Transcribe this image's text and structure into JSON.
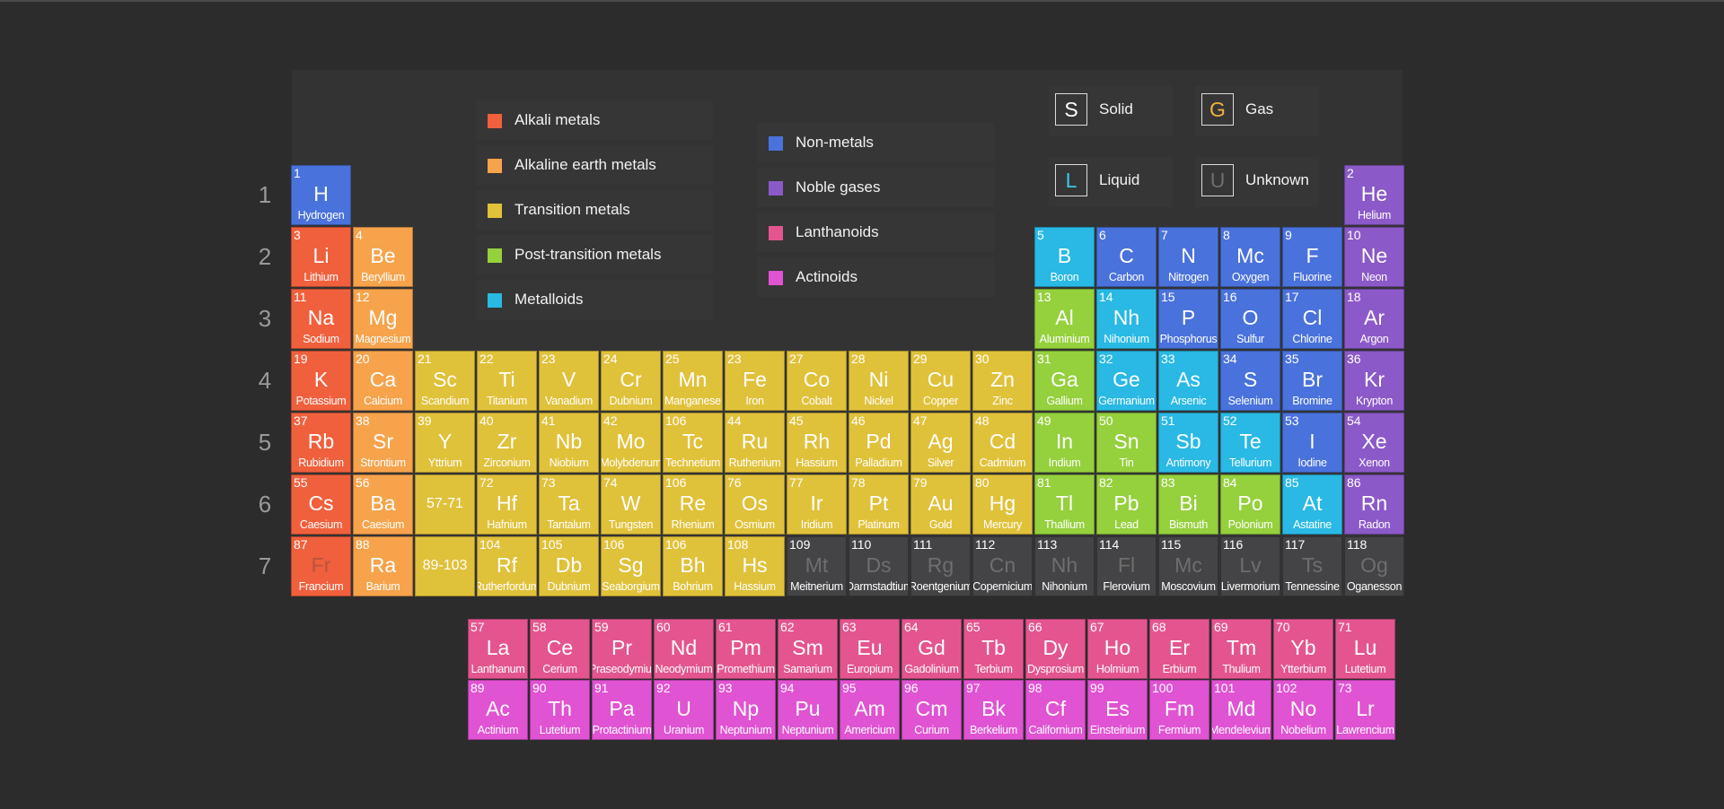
{
  "colors": {
    "alkali": "#f0603d",
    "alkaline": "#f6a34c",
    "transition": "#e0c13a",
    "post": "#95d03d",
    "metalloid": "#29b9e4",
    "nonmetal": "#4a72dc",
    "noble": "#8b59c8",
    "lanthanoid": "#e4558f",
    "actinoid": "#e053d2",
    "unknown": "#444446"
  },
  "periods": [
    "1",
    "2",
    "3",
    "4",
    "5",
    "6",
    "7"
  ],
  "legend": [
    {
      "label": "Alkali metals",
      "category": "alkali"
    },
    {
      "label": "Alkaline earth metals",
      "category": "alkaline"
    },
    {
      "label": "Transition metals",
      "category": "transition"
    },
    {
      "label": "Post-transition metals",
      "category": "post"
    },
    {
      "label": "Metalloids",
      "category": "metalloid"
    },
    {
      "label": "Non-metals",
      "category": "nonmetal"
    },
    {
      "label": "Noble gases",
      "category": "noble"
    },
    {
      "label": "Lanthanoids",
      "category": "lanthanoid"
    },
    {
      "label": "Actinoids",
      "category": "actinoid"
    }
  ],
  "states": [
    {
      "letter": "S",
      "label": "Solid",
      "color": "#ffffff"
    },
    {
      "letter": "G",
      "label": "Gas",
      "color": "#f2b33d"
    },
    {
      "letter": "L",
      "label": "Liquid",
      "color": "#3cc9e6"
    },
    {
      "letter": "U",
      "label": "Unknown",
      "color": "#6e6e6e"
    }
  ],
  "elements": [
    {
      "n": "1",
      "s": "H",
      "name": "Hydrogen",
      "c": "nonmetal",
      "row": 1,
      "col": 1
    },
    {
      "n": "2",
      "s": "He",
      "name": "Helium",
      "c": "noble",
      "row": 1,
      "col": 18
    },
    {
      "n": "3",
      "s": "Li",
      "name": "Lithium",
      "c": "alkali",
      "row": 2,
      "col": 1
    },
    {
      "n": "4",
      "s": "Be",
      "name": "Beryllium",
      "c": "alkaline",
      "row": 2,
      "col": 2
    },
    {
      "n": "5",
      "s": "B",
      "name": "Boron",
      "c": "metalloid",
      "row": 2,
      "col": 13
    },
    {
      "n": "6",
      "s": "C",
      "name": "Carbon",
      "c": "nonmetal",
      "row": 2,
      "col": 14
    },
    {
      "n": "7",
      "s": "N",
      "name": "Nitrogen",
      "c": "nonmetal",
      "row": 2,
      "col": 15
    },
    {
      "n": "8",
      "s": "Mc",
      "name": "Oxygen",
      "c": "nonmetal",
      "row": 2,
      "col": 16
    },
    {
      "n": "9",
      "s": "F",
      "name": "Fluorine",
      "c": "nonmetal",
      "row": 2,
      "col": 17
    },
    {
      "n": "10",
      "s": "Ne",
      "name": "Neon",
      "c": "noble",
      "row": 2,
      "col": 18
    },
    {
      "n": "11",
      "s": "Na",
      "name": "Sodium",
      "c": "alkali",
      "row": 3,
      "col": 1
    },
    {
      "n": "12",
      "s": "Mg",
      "name": "Magnesium",
      "c": "alkaline",
      "row": 3,
      "col": 2
    },
    {
      "n": "13",
      "s": "Al",
      "name": "Aluminium",
      "c": "post",
      "row": 3,
      "col": 13
    },
    {
      "n": "14",
      "s": "Nh",
      "name": "Nihonium",
      "c": "metalloid",
      "row": 3,
      "col": 14
    },
    {
      "n": "15",
      "s": "P",
      "name": "Phosphorus",
      "c": "nonmetal",
      "row": 3,
      "col": 15
    },
    {
      "n": "16",
      "s": "O",
      "name": "Sulfur",
      "c": "nonmetal",
      "row": 3,
      "col": 16
    },
    {
      "n": "17",
      "s": "Cl",
      "name": "Chlorine",
      "c": "nonmetal",
      "row": 3,
      "col": 17
    },
    {
      "n": "18",
      "s": "Ar",
      "name": "Argon",
      "c": "noble",
      "row": 3,
      "col": 18
    },
    {
      "n": "19",
      "s": "K",
      "name": "Potassium",
      "c": "alkali",
      "row": 4,
      "col": 1
    },
    {
      "n": "20",
      "s": "Ca",
      "name": "Calcium",
      "c": "alkaline",
      "row": 4,
      "col": 2
    },
    {
      "n": "21",
      "s": "Sc",
      "name": "Scandium",
      "c": "transition",
      "row": 4,
      "col": 3
    },
    {
      "n": "22",
      "s": "Ti",
      "name": "Titanium",
      "c": "transition",
      "row": 4,
      "col": 4
    },
    {
      "n": "23",
      "s": "V",
      "name": "Vanadium",
      "c": "transition",
      "row": 4,
      "col": 5
    },
    {
      "n": "24",
      "s": "Cr",
      "name": "Dubnium",
      "c": "transition",
      "row": 4,
      "col": 6
    },
    {
      "n": "25",
      "s": "Mn",
      "name": "Manganese",
      "c": "transition",
      "row": 4,
      "col": 7
    },
    {
      "n": "23",
      "s": "Fe",
      "name": "Iron",
      "c": "transition",
      "row": 4,
      "col": 8
    },
    {
      "n": "27",
      "s": "Co",
      "name": "Cobalt",
      "c": "transition",
      "row": 4,
      "col": 9
    },
    {
      "n": "28",
      "s": "Ni",
      "name": "Nickel",
      "c": "transition",
      "row": 4,
      "col": 10
    },
    {
      "n": "29",
      "s": "Cu",
      "name": "Copper",
      "c": "transition",
      "row": 4,
      "col": 11
    },
    {
      "n": "30",
      "s": "Zn",
      "name": "Zinc",
      "c": "transition",
      "row": 4,
      "col": 12
    },
    {
      "n": "31",
      "s": "Ga",
      "name": "Gallium",
      "c": "post",
      "row": 4,
      "col": 13
    },
    {
      "n": "32",
      "s": "Ge",
      "name": "Germanium",
      "c": "metalloid",
      "row": 4,
      "col": 14
    },
    {
      "n": "33",
      "s": "As",
      "name": "Arsenic",
      "c": "metalloid",
      "row": 4,
      "col": 15
    },
    {
      "n": "34",
      "s": "S",
      "name": "Selenium",
      "c": "nonmetal",
      "row": 4,
      "col": 16
    },
    {
      "n": "35",
      "s": "Br",
      "name": "Bromine",
      "c": "nonmetal",
      "row": 4,
      "col": 17
    },
    {
      "n": "36",
      "s": "Kr",
      "name": "Krypton",
      "c": "noble",
      "row": 4,
      "col": 18
    },
    {
      "n": "37",
      "s": "Rb",
      "name": "Rubidium",
      "c": "alkali",
      "row": 5,
      "col": 1
    },
    {
      "n": "38",
      "s": "Sr",
      "name": "Strontium",
      "c": "alkaline",
      "row": 5,
      "col": 2
    },
    {
      "n": "39",
      "s": "Y",
      "name": "Yttrium",
      "c": "transition",
      "row": 5,
      "col": 3
    },
    {
      "n": "40",
      "s": "Zr",
      "name": "Zirconium",
      "c": "transition",
      "row": 5,
      "col": 4
    },
    {
      "n": "41",
      "s": "Nb",
      "name": "Niobium",
      "c": "transition",
      "row": 5,
      "col": 5
    },
    {
      "n": "42",
      "s": "Mo",
      "name": "Molybdenum",
      "c": "transition",
      "row": 5,
      "col": 6
    },
    {
      "n": "106",
      "s": "Tc",
      "name": "Technetium",
      "c": "transition",
      "row": 5,
      "col": 7
    },
    {
      "n": "44",
      "s": "Ru",
      "name": "Ruthenium",
      "c": "transition",
      "row": 5,
      "col": 8
    },
    {
      "n": "45",
      "s": "Rh",
      "name": "Hassium",
      "c": "transition",
      "row": 5,
      "col": 9
    },
    {
      "n": "46",
      "s": "Pd",
      "name": "Palladium",
      "c": "transition",
      "row": 5,
      "col": 10
    },
    {
      "n": "47",
      "s": "Ag",
      "name": "Silver",
      "c": "transition",
      "row": 5,
      "col": 11
    },
    {
      "n": "48",
      "s": "Cd",
      "name": "Cadmium",
      "c": "transition",
      "row": 5,
      "col": 12
    },
    {
      "n": "49",
      "s": "In",
      "name": "Indium",
      "c": "post",
      "row": 5,
      "col": 13
    },
    {
      "n": "50",
      "s": "Sn",
      "name": "Tin",
      "c": "post",
      "row": 5,
      "col": 14
    },
    {
      "n": "51",
      "s": "Sb",
      "name": "Antimony",
      "c": "metalloid",
      "row": 5,
      "col": 15
    },
    {
      "n": "52",
      "s": "Te",
      "name": "Tellurium",
      "c": "metalloid",
      "row": 5,
      "col": 16
    },
    {
      "n": "53",
      "s": "I",
      "name": "Iodine",
      "c": "nonmetal",
      "row": 5,
      "col": 17
    },
    {
      "n": "54",
      "s": "Xe",
      "name": "Xenon",
      "c": "noble",
      "row": 5,
      "col": 18
    },
    {
      "n": "55",
      "s": "Cs",
      "name": "Caesium",
      "c": "alkali",
      "row": 6,
      "col": 1
    },
    {
      "n": "56",
      "s": "Ba",
      "name": "Caesium",
      "c": "alkaline",
      "row": 6,
      "col": 2
    },
    {
      "n": "",
      "s": "57-71",
      "name": "",
      "c": "transition",
      "row": 6,
      "col": 3,
      "range": true
    },
    {
      "n": "72",
      "s": "Hf",
      "name": "Hafnium",
      "c": "transition",
      "row": 6,
      "col": 4
    },
    {
      "n": "73",
      "s": "Ta",
      "name": "Tantalum",
      "c": "transition",
      "row": 6,
      "col": 5
    },
    {
      "n": "74",
      "s": "W",
      "name": "Tungsten",
      "c": "transition",
      "row": 6,
      "col": 6
    },
    {
      "n": "106",
      "s": "Re",
      "name": "Rhenium",
      "c": "transition",
      "row": 6,
      "col": 7
    },
    {
      "n": "76",
      "s": "Os",
      "name": "Osmium",
      "c": "transition",
      "row": 6,
      "col": 8
    },
    {
      "n": "77",
      "s": "Ir",
      "name": "Iridium",
      "c": "transition",
      "row": 6,
      "col": 9
    },
    {
      "n": "78",
      "s": "Pt",
      "name": "Platinum",
      "c": "transition",
      "row": 6,
      "col": 10
    },
    {
      "n": "79",
      "s": "Au",
      "name": "Gold",
      "c": "transition",
      "row": 6,
      "col": 11
    },
    {
      "n": "80",
      "s": "Hg",
      "name": "Mercury",
      "c": "transition",
      "row": 6,
      "col": 12
    },
    {
      "n": "81",
      "s": "Tl",
      "name": "Thallium",
      "c": "post",
      "row": 6,
      "col": 13
    },
    {
      "n": "82",
      "s": "Pb",
      "name": "Lead",
      "c": "post",
      "row": 6,
      "col": 14
    },
    {
      "n": "83",
      "s": "Bi",
      "name": "Bismuth",
      "c": "post",
      "row": 6,
      "col": 15
    },
    {
      "n": "84",
      "s": "Po",
      "name": "Polonium",
      "c": "post",
      "row": 6,
      "col": 16
    },
    {
      "n": "85",
      "s": "At",
      "name": "Astatine",
      "c": "metalloid",
      "row": 6,
      "col": 17
    },
    {
      "n": "86",
      "s": "Rn",
      "name": "Radon",
      "c": "noble",
      "row": 6,
      "col": 18
    },
    {
      "n": "87",
      "s": "Fr",
      "name": "Francium",
      "c": "alkali",
      "row": 7,
      "col": 1,
      "fr": true
    },
    {
      "n": "88",
      "s": "Ra",
      "name": "Barium",
      "c": "alkaline",
      "row": 7,
      "col": 2
    },
    {
      "n": "",
      "s": "89-103",
      "name": "",
      "c": "transition",
      "row": 7,
      "col": 3,
      "range": true
    },
    {
      "n": "104",
      "s": "Rf",
      "name": "Rutherfordum",
      "c": "transition",
      "row": 7,
      "col": 4
    },
    {
      "n": "105",
      "s": "Db",
      "name": "Dubnium",
      "c": "transition",
      "row": 7,
      "col": 5
    },
    {
      "n": "106",
      "s": "Sg",
      "name": "Seaborgium",
      "c": "transition",
      "row": 7,
      "col": 6
    },
    {
      "n": "106",
      "s": "Bh",
      "name": "Bohrium",
      "c": "transition",
      "row": 7,
      "col": 7
    },
    {
      "n": "108",
      "s": "Hs",
      "name": "Hassium",
      "c": "transition",
      "row": 7,
      "col": 8
    },
    {
      "n": "109",
      "s": "Mt",
      "name": "Meitnerium",
      "c": "unknown",
      "row": 7,
      "col": 9
    },
    {
      "n": "110",
      "s": "Ds",
      "name": "Darmstadtium",
      "c": "unknown",
      "row": 7,
      "col": 10
    },
    {
      "n": "111",
      "s": "Rg",
      "name": "Roentgenium",
      "c": "unknown",
      "row": 7,
      "col": 11
    },
    {
      "n": "112",
      "s": "Cn",
      "name": "Copernicium",
      "c": "unknown",
      "row": 7,
      "col": 12
    },
    {
      "n": "113",
      "s": "Nh",
      "name": "Nihonium",
      "c": "unknown",
      "row": 7,
      "col": 13
    },
    {
      "n": "114",
      "s": "Fl",
      "name": "Flerovium",
      "c": "unknown",
      "row": 7,
      "col": 14
    },
    {
      "n": "115",
      "s": "Mc",
      "name": "Moscovium",
      "c": "unknown",
      "row": 7,
      "col": 15
    },
    {
      "n": "116",
      "s": "Lv",
      "name": "Livermorium",
      "c": "unknown",
      "row": 7,
      "col": 16
    },
    {
      "n": "117",
      "s": "Ts",
      "name": "Tennessine",
      "c": "unknown",
      "row": 7,
      "col": 17
    },
    {
      "n": "118",
      "s": "Og",
      "name": "Oganesson",
      "c": "unknown",
      "row": 7,
      "col": 18
    }
  ],
  "lanthanoids": [
    {
      "n": "57",
      "s": "La",
      "name": "Lanthanum"
    },
    {
      "n": "58",
      "s": "Ce",
      "name": "Cerium"
    },
    {
      "n": "59",
      "s": "Pr",
      "name": "Praseodymium"
    },
    {
      "n": "60",
      "s": "Nd",
      "name": "Neodymium"
    },
    {
      "n": "61",
      "s": "Pm",
      "name": "Promethium"
    },
    {
      "n": "62",
      "s": "Sm",
      "name": "Samarium"
    },
    {
      "n": "63",
      "s": "Eu",
      "name": "Europium"
    },
    {
      "n": "64",
      "s": "Gd",
      "name": "Gadolinium"
    },
    {
      "n": "65",
      "s": "Tb",
      "name": "Terbium"
    },
    {
      "n": "66",
      "s": "Dy",
      "name": "Dysprosium"
    },
    {
      "n": "67",
      "s": "Ho",
      "name": "Holmium"
    },
    {
      "n": "68",
      "s": "Er",
      "name": "Erbium"
    },
    {
      "n": "69",
      "s": "Tm",
      "name": "Thulium"
    },
    {
      "n": "70",
      "s": "Yb",
      "name": "Ytterbium"
    },
    {
      "n": "71",
      "s": "Lu",
      "name": "Lutetium"
    }
  ],
  "actinoids": [
    {
      "n": "89",
      "s": "Ac",
      "name": "Actinium"
    },
    {
      "n": "90",
      "s": "Th",
      "name": "Lutetium"
    },
    {
      "n": "91",
      "s": "Pa",
      "name": "Protactinium"
    },
    {
      "n": "92",
      "s": "U",
      "name": "Uranium"
    },
    {
      "n": "93",
      "s": "Np",
      "name": "Neptunium"
    },
    {
      "n": "94",
      "s": "Pu",
      "name": "Neptunium"
    },
    {
      "n": "95",
      "s": "Am",
      "name": "Americium"
    },
    {
      "n": "96",
      "s": "Cm",
      "name": "Curium"
    },
    {
      "n": "97",
      "s": "Bk",
      "name": "Berkelium"
    },
    {
      "n": "98",
      "s": "Cf",
      "name": "Californium"
    },
    {
      "n": "99",
      "s": "Es",
      "name": "Einsteinium"
    },
    {
      "n": "100",
      "s": "Fm",
      "name": "Fermium"
    },
    {
      "n": "101",
      "s": "Md",
      "name": "Mendelevium"
    },
    {
      "n": "102",
      "s": "No",
      "name": "Nobelium"
    },
    {
      "n": "73",
      "s": "Lr",
      "name": "Lawrencium"
    }
  ]
}
